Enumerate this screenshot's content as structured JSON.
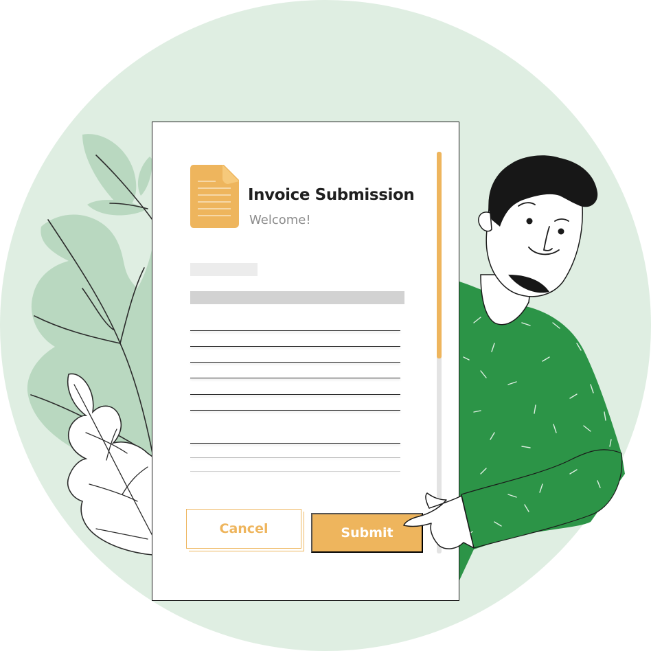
{
  "form": {
    "title": "Invoice Submission",
    "subtitle": "Welcome!",
    "cancel_label": "Cancel",
    "submit_label": "Submit",
    "scroll_position": 0.5
  },
  "icons": {
    "document": "document-icon"
  },
  "colors": {
    "accent": "#eeb55d",
    "background_circle": "#dfeee2",
    "sweater": "#2c9447",
    "hair": "#171717",
    "leaf_green": "#b9d8c0"
  }
}
